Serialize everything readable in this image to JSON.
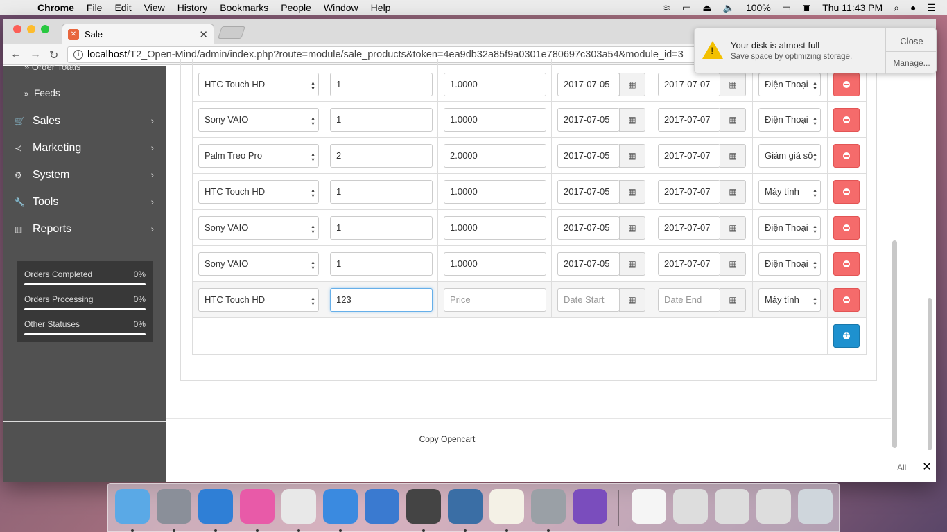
{
  "menubar": {
    "apple": "",
    "app": "Chrome",
    "items": [
      "File",
      "Edit",
      "View",
      "History",
      "Bookmarks",
      "People",
      "Window",
      "Help"
    ],
    "battery": "100%",
    "clock": "Thu 11:43 PM"
  },
  "browser": {
    "tab_title": "Sale",
    "url_host": "localhost",
    "url_path": "/T2_Open-Mind/admin/index.php?route=module/sale_products&token=4ea9db32a85f9a0301e780697c303a54&module_id=3"
  },
  "sidebar": {
    "top_cut": "Order Totals",
    "child": "Feeds",
    "items": [
      {
        "label": "Sales",
        "icon": "cart-icon"
      },
      {
        "label": "Marketing",
        "icon": "share-icon"
      },
      {
        "label": "System",
        "icon": "gear-icon"
      },
      {
        "label": "Tools",
        "icon": "wrench-icon"
      },
      {
        "label": "Reports",
        "icon": "bar-chart-icon"
      }
    ],
    "stats": [
      {
        "label": "Orders Completed",
        "pct": "0%"
      },
      {
        "label": "Orders Processing",
        "pct": "0%"
      },
      {
        "label": "Other Statuses",
        "pct": "0%"
      }
    ]
  },
  "rows": [
    {
      "product": "HTC Touch HD",
      "qty": "1",
      "price": "1.0000",
      "start": "2017-07-05",
      "end": "2017-07-07",
      "group": "Điện Thoại"
    },
    {
      "product": "Sony VAIO",
      "qty": "1",
      "price": "1.0000",
      "start": "2017-07-05",
      "end": "2017-07-07",
      "group": "Điện Thoại"
    },
    {
      "product": "Palm Treo Pro",
      "qty": "2",
      "price": "2.0000",
      "start": "2017-07-05",
      "end": "2017-07-07",
      "group": "Giảm giá số"
    },
    {
      "product": "HTC Touch HD",
      "qty": "1",
      "price": "1.0000",
      "start": "2017-07-05",
      "end": "2017-07-07",
      "group": "Máy tính"
    },
    {
      "product": "Sony VAIO",
      "qty": "1",
      "price": "1.0000",
      "start": "2017-07-05",
      "end": "2017-07-07",
      "group": "Điện Thoại"
    },
    {
      "product": "Sony VAIO",
      "qty": "1",
      "price": "1.0000",
      "start": "2017-07-05",
      "end": "2017-07-07",
      "group": "Điện Thoại"
    }
  ],
  "new_row": {
    "product": "HTC Touch HD",
    "qty": "123",
    "price_placeholder": "Price",
    "start_placeholder": "Date Start",
    "end_placeholder": "Date End",
    "group": "Máy tính"
  },
  "footer": "Copy Opencart",
  "notification": {
    "title": "Your disk is almost full",
    "body": "Save space by optimizing storage.",
    "close": "Close",
    "manage": "Manage..."
  },
  "download_bar": {
    "show_all": "All",
    "close": "✕"
  },
  "dock": [
    "Finder",
    "Launchpad",
    "Safari",
    "iTunes",
    "Chrome",
    "Simulator",
    "Xcode",
    "Sublime Text",
    "MySQL Workbench",
    "TextEdit",
    "System Preferences",
    "GitHub Desktop",
    "Document",
    "Screenshot 1",
    "Screenshot 2",
    "Screenshot 3",
    "Trash"
  ]
}
